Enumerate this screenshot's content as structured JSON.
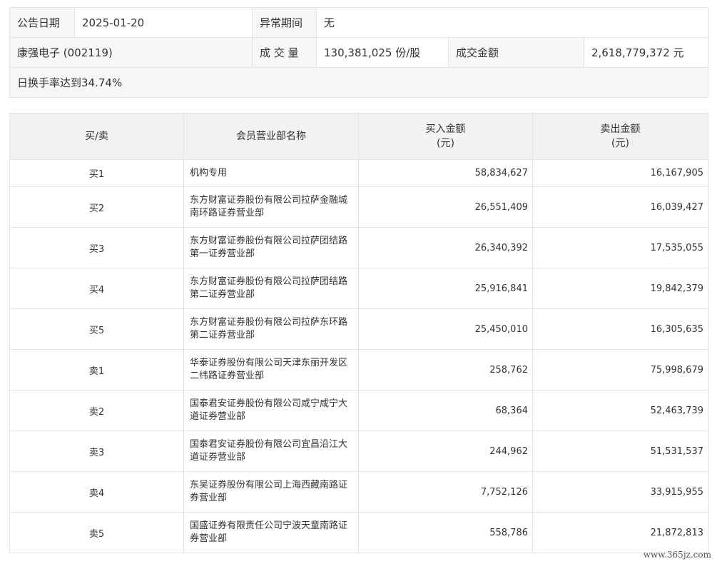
{
  "summary": {
    "announce_date_label": "公告日期",
    "announce_date": "2025-01-20",
    "abnormal_period_label": "异常期间",
    "abnormal_period": "无",
    "stock": "康强电子 (002119)",
    "volume_label": "成 交 量",
    "volume": "130,381,025 份/股",
    "turnover_label": "成交金额",
    "turnover": "2,618,779,372 元",
    "reason": "日换手率达到34.74%"
  },
  "detail": {
    "headers": {
      "side": "买/卖",
      "dept": "会员营业部名称",
      "buy_line1": "买入金额",
      "buy_line2": "(元)",
      "sell_line1": "卖出金额",
      "sell_line2": "(元)"
    },
    "rows": [
      {
        "side": "买1",
        "dept": "机构专用",
        "buy": "58,834,627",
        "sell": "16,167,905"
      },
      {
        "side": "买2",
        "dept": "东方财富证券股份有限公司拉萨金融城南环路证券营业部",
        "buy": "26,551,409",
        "sell": "16,039,427"
      },
      {
        "side": "买3",
        "dept": "东方财富证券股份有限公司拉萨团结路第一证券营业部",
        "buy": "26,340,392",
        "sell": "17,535,055"
      },
      {
        "side": "买4",
        "dept": "东方财富证券股份有限公司拉萨团结路第二证券营业部",
        "buy": "25,916,841",
        "sell": "19,842,379"
      },
      {
        "side": "买5",
        "dept": "东方财富证券股份有限公司拉萨东环路第二证券营业部",
        "buy": "25,450,010",
        "sell": "16,305,635"
      },
      {
        "side": "卖1",
        "dept": "华泰证券股份有限公司天津东丽开发区二纬路证券营业部",
        "buy": "258,762",
        "sell": "75,998,679"
      },
      {
        "side": "卖2",
        "dept": "国泰君安证券股份有限公司咸宁咸宁大道证券营业部",
        "buy": "68,364",
        "sell": "52,463,739"
      },
      {
        "side": "卖3",
        "dept": "国泰君安证券股份有限公司宜昌沿江大道证券营业部",
        "buy": "244,962",
        "sell": "51,531,537"
      },
      {
        "side": "卖4",
        "dept": "东吴证券股份有限公司上海西藏南路证券营业部",
        "buy": "7,752,126",
        "sell": "33,915,955"
      },
      {
        "side": "卖5",
        "dept": "国盛证券有限责任公司宁波天童南路证券营业部",
        "buy": "558,786",
        "sell": "21,872,813"
      }
    ]
  },
  "watermark": "www.365jz.com"
}
